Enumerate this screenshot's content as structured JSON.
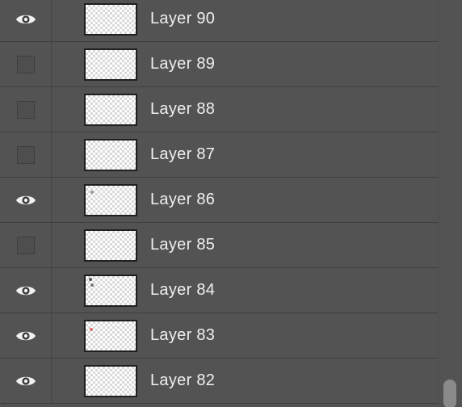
{
  "layers_panel": {
    "layers": [
      {
        "name": "Layer 90",
        "visible": true,
        "thumb_marks": []
      },
      {
        "name": "Layer 89",
        "visible": false,
        "thumb_marks": []
      },
      {
        "name": "Layer 88",
        "visible": false,
        "thumb_marks": []
      },
      {
        "name": "Layer 87",
        "visible": false,
        "thumb_marks": []
      },
      {
        "name": "Layer 86",
        "visible": true,
        "thumb_marks": [
          {
            "color": "#9a9a9a"
          }
        ]
      },
      {
        "name": "Layer 85",
        "visible": false,
        "thumb_marks": []
      },
      {
        "name": "Layer 84",
        "visible": true,
        "thumb_marks": [
          {
            "color": "#555555"
          },
          {
            "color": "#777777"
          }
        ]
      },
      {
        "name": "Layer 83",
        "visible": true,
        "thumb_marks": [
          {
            "color": "#e06a6a"
          }
        ]
      },
      {
        "name": "Layer 82",
        "visible": true,
        "thumb_marks": []
      }
    ]
  },
  "icons": {
    "visibility": "eye-icon",
    "hidden": "empty-visibility-box"
  },
  "colors": {
    "panel_bg": "#535353",
    "row_divider": "#3f3f3f",
    "text": "#f0f0f0",
    "scroll_thumb": "#8a8a8a"
  }
}
